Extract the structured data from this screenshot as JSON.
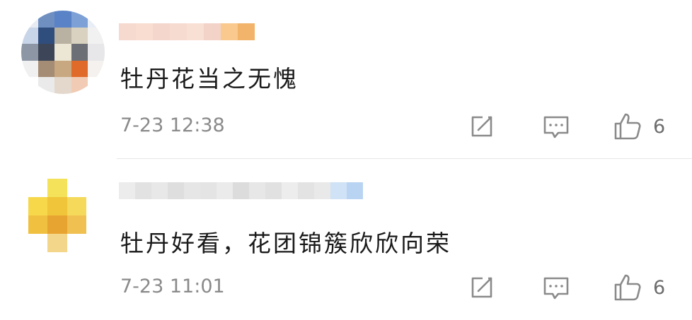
{
  "comments": [
    {
      "username": "",
      "text": "牡丹花当之无愧",
      "time": "7-23 12:38",
      "likes": "6",
      "icons": {
        "share": "share-icon",
        "comment": "comment-icon",
        "like": "like-icon"
      },
      "avatar_colors": [
        "#e8ecf2",
        "#6f8fc0",
        "#5a82c6",
        "#7da0d6",
        "#e9eef6",
        "#c8d5e8",
        "#2f4e7e",
        "#b9b2a2",
        "#d9d2c0",
        "#f1f1f1",
        "#8c96a4",
        "#3c4658",
        "#ece6d4",
        "#6c6f76",
        "#e7e7ea",
        "#f0f0f0",
        "#a58c74",
        "#c8a880",
        "#e06a2a",
        "#f4f1ee",
        "#ffffff",
        "#eaeaea",
        "#e4d8cc",
        "#f1cbb4",
        "#ffffff"
      ],
      "username_colors": [
        "#f6d9cf",
        "#f8ddd0",
        "#f4d6cc",
        "#f6dbd0",
        "#f8e0d4",
        "#f3d2c8",
        "#f9c98e",
        "#f2b36a"
      ]
    },
    {
      "username": "",
      "text": "牡丹好看，花团锦簇欣欣向荣",
      "time": "7-23 11:01",
      "likes": "6",
      "icons": {
        "share": "share-icon",
        "comment": "comment-icon",
        "like": "like-icon"
      },
      "avatar_colors": [
        "#ffffff",
        "#f4e25a",
        "#ffffff",
        "#f6d84a",
        "#f0c53a",
        "#f4d95a",
        "#f0c040",
        "#e8a430",
        "#f0c050",
        "#ffffff",
        "#f4d68a",
        "#ffffff"
      ],
      "username_colors": [
        "#ececec",
        "#e2e2e2",
        "#e8e8e8",
        "#dedede",
        "#e6e6e6",
        "#e4e4e4",
        "#ebebeb",
        "#dcdcdc",
        "#e7e7e7",
        "#e1e1e1",
        "#ededed",
        "#e3e3e3",
        "#e9e9e9",
        "#cfe2f6",
        "#b9d4f2"
      ]
    }
  ]
}
